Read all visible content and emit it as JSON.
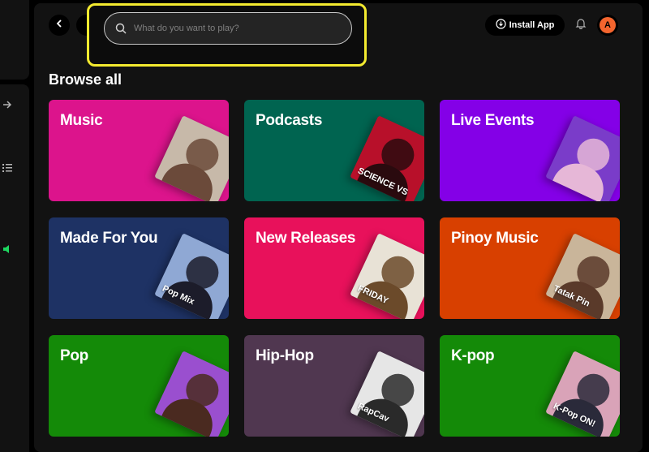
{
  "search": {
    "placeholder": "What do you want to play?"
  },
  "header": {
    "install_label": "Install App",
    "avatar_initial": "A"
  },
  "browse": {
    "title": "Browse all",
    "cards": [
      {
        "label": "Music",
        "color": "#dc148c",
        "art": {
          "bg": "#c7b9a9",
          "fg": "#6b4a3a",
          "text": ""
        }
      },
      {
        "label": "Podcasts",
        "color": "#006450",
        "art": {
          "bg": "#b8102a",
          "fg": "#2a0a0e",
          "text": "SCIENCE VS"
        }
      },
      {
        "label": "Live Events",
        "color": "#8400e7",
        "art": {
          "bg": "#7a3cc9",
          "fg": "#e6b7d7",
          "text": ""
        }
      },
      {
        "label": "Made For You",
        "color": "#1e3264",
        "art": {
          "bg": "#8fa8d4",
          "fg": "#1c1c2a",
          "text": "Pop Mix"
        }
      },
      {
        "label": "New Releases",
        "color": "#e8115b",
        "art": {
          "bg": "#e8e2d6",
          "fg": "#6b4a2a",
          "text": "FRIDAY"
        }
      },
      {
        "label": "Pinoy Music",
        "color": "#d84000",
        "art": {
          "bg": "#c9b59a",
          "fg": "#5a3a2a",
          "text": "Tatak Pin"
        }
      },
      {
        "label": "Pop",
        "color": "#148a08",
        "art": {
          "bg": "#9a4fcf",
          "fg": "#4a2a20",
          "text": ""
        }
      },
      {
        "label": "Hip-Hop",
        "color": "#503750",
        "art": {
          "bg": "#e6e6e6",
          "fg": "#2a2a2a",
          "text": "RapCav"
        }
      },
      {
        "label": "K-pop",
        "color": "#148a08",
        "art": {
          "bg": "#d9a3b8",
          "fg": "#2a2a3a",
          "text": "K-Pop ON!"
        }
      }
    ]
  }
}
